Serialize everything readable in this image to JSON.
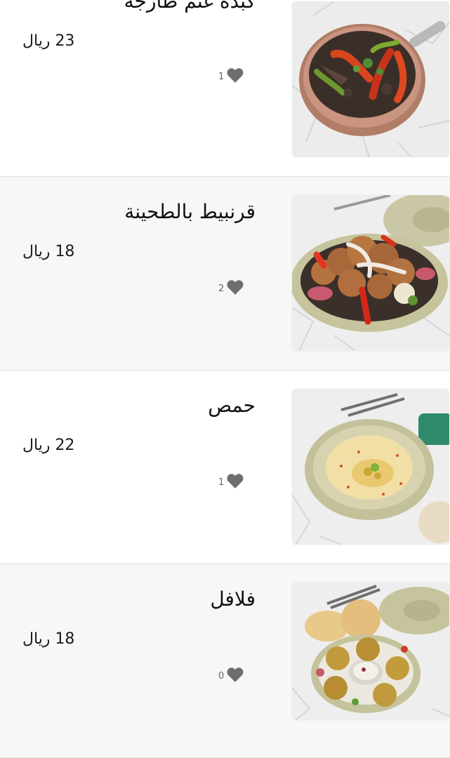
{
  "menu": {
    "currency": "ريال",
    "items": [
      {
        "name": "كبدة غنم طازجة",
        "price": "23 ريال",
        "likes": "1",
        "image": "liver-skillet-photo"
      },
      {
        "name": "قرنبيط بالطحينة",
        "price": "18 ريال",
        "likes": "2",
        "image": "cauliflower-tahini-photo"
      },
      {
        "name": "حمص",
        "price": "22 ريال",
        "likes": "1",
        "image": "hummus-bowl-photo"
      },
      {
        "name": "فلافل",
        "price": "18 ريال",
        "likes": "0",
        "image": "falafel-plate-photo"
      }
    ]
  },
  "icons": {
    "like": "heart-icon"
  },
  "colors": {
    "heart": "#6e6e6e",
    "alt_row_background": "#f7f7f7",
    "divider": "#dedede"
  }
}
